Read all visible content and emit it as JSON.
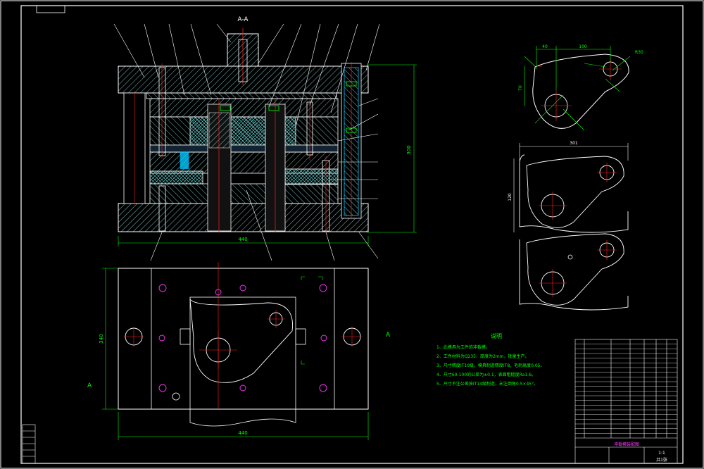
{
  "section_label": "A-A",
  "section_mark": "A",
  "dimensions": {
    "main_width": "440",
    "main_height": "300",
    "plan_width": "440",
    "plan_height": "340",
    "part_40": "40",
    "part_100": "100",
    "part_70": "70",
    "part_r30": "R30",
    "strip_width": "301",
    "strip_height": "120"
  },
  "notes": {
    "title": "说明",
    "items": [
      "1、此模具为工件的冲裁模。",
      "2、工件材料为Q235，厚度为2mm，批量生产。",
      "3、尺寸精度IT10级，模具制造精度IT8，毛刺高度0.05。",
      "4、尺寸60-100的公差为±0.1，表面粗糙度Ra1.6。",
      "5、尺寸不注公差按IT14级制造，未注倒角0.5×45°。"
    ]
  },
  "title_block": {
    "drawing_name": "冲裁模装配图",
    "scale": "1:1",
    "sheet": "共1张"
  },
  "colors": {
    "bg": "#000000",
    "frame": "#ffffff",
    "outline": "#ffffff",
    "hatch": "#9fd0d0",
    "dim": "#00ff00",
    "center": "#ff2020",
    "cyan": "#00c8ff",
    "magenta": "#ff33ff",
    "yellow": "#ffff00",
    "text": "#ffffff"
  }
}
